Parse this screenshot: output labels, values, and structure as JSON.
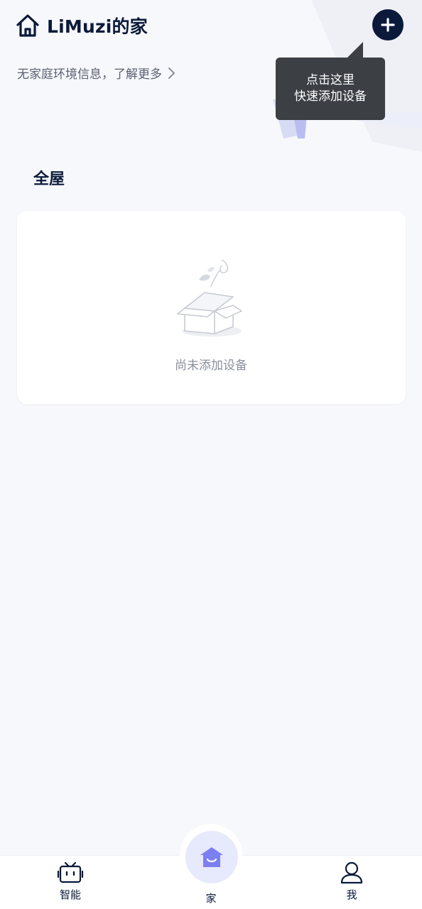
{
  "header": {
    "title": "LiMuzi的家",
    "home_icon": "home-icon",
    "add_icon": "plus-icon"
  },
  "env_info": {
    "text": "无家庭环境信息，了解更多",
    "icon": "chevron-right-icon"
  },
  "tooltip": {
    "line1": "点击这里",
    "line2": "快速添加设备"
  },
  "section": {
    "title": "全屋"
  },
  "empty_state": {
    "icon": "empty-box-icon",
    "text": "尚未添加设备"
  },
  "bottom_nav": {
    "items": [
      {
        "label": "智能",
        "icon": "tv-robot-icon"
      },
      {
        "label": "家",
        "icon": "home-smile-icon"
      },
      {
        "label": "我",
        "icon": "person-icon"
      }
    ],
    "active_index": 1
  },
  "colors": {
    "primary_dark": "#0b1a3a",
    "accent_lavender": "#e7e9fc",
    "accent_purple": "#7b7ff0",
    "tooltip_bg": "#3c3f44",
    "page_bg": "#f7f8fb"
  }
}
